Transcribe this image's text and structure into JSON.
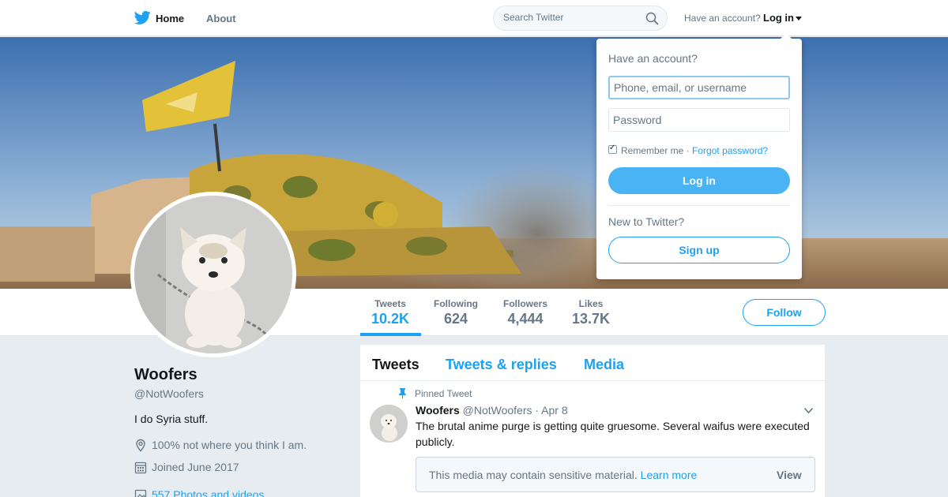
{
  "nav": {
    "logo_icon": "twitter-bird-icon",
    "home": "Home",
    "about": "About",
    "search_placeholder": "Search Twitter",
    "have_account": "Have an account?",
    "login": "Log in"
  },
  "profile": {
    "name": "Woofers",
    "handle": "@NotWoofers",
    "bio": "I do Syria stuff.",
    "location": "100% not where you think I am.",
    "joined": "Joined June 2017",
    "photos": "557 Photos and videos"
  },
  "stats": [
    {
      "label": "Tweets",
      "value": "10.2K"
    },
    {
      "label": "Following",
      "value": "624"
    },
    {
      "label": "Followers",
      "value": "4,444"
    },
    {
      "label": "Likes",
      "value": "13.7K"
    }
  ],
  "follow_label": "Follow",
  "timeline": {
    "tabs": [
      "Tweets",
      "Tweets & replies",
      "Media"
    ],
    "pinned_label": "Pinned Tweet",
    "tweet": {
      "name": "Woofers",
      "handle": "@NotWoofers",
      "date": "· Apr 8",
      "text": "The brutal anime purge is getting quite gruesome. Several waifus were executed publicly.",
      "sensitive_text": "This media may contain sensitive material.",
      "learn_more": "Learn more",
      "view": "View"
    }
  },
  "login_dropdown": {
    "title": "Have an account?",
    "username_placeholder": "Phone, email, or username",
    "password_placeholder": "Password",
    "remember": "Remember me",
    "separator": "·",
    "forgot": "Forgot password?",
    "login_button": "Log in",
    "new_to": "New to Twitter?",
    "signup_button": "Sign up"
  },
  "colors": {
    "accent": "#1da1f2",
    "login_button": "#4ab3f4",
    "muted": "#657786",
    "background": "#e6ecf0"
  }
}
